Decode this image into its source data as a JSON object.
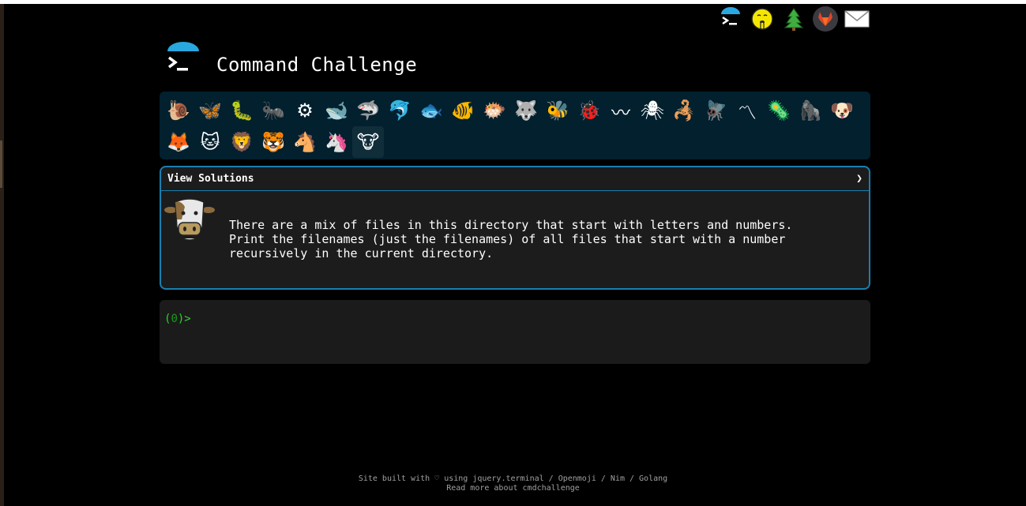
{
  "header": {
    "title": "Command Challenge",
    "links": [
      {
        "name": "home-link",
        "icon": "terminal-icon"
      },
      {
        "name": "hint-link",
        "icon": "lips-finger-emoji-icon"
      },
      {
        "name": "tree-link",
        "icon": "evergreen-tree-icon"
      },
      {
        "name": "gitlab-link",
        "icon": "gitlab-fox-icon"
      },
      {
        "name": "email-link",
        "icon": "envelope-icon"
      }
    ]
  },
  "animals": {
    "row1": [
      {
        "id": "snail",
        "glyph": "🐌"
      },
      {
        "id": "butterfly",
        "glyph": "🦋"
      },
      {
        "id": "caterpillar",
        "glyph": "🐛"
      },
      {
        "id": "ant",
        "glyph": "🐜"
      },
      {
        "id": "gear-bug",
        "glyph": "⚙"
      },
      {
        "id": "whale",
        "glyph": "🐋"
      },
      {
        "id": "shark",
        "glyph": "🦈"
      },
      {
        "id": "dolphin",
        "glyph": "🐬"
      },
      {
        "id": "fish",
        "glyph": "🐟"
      },
      {
        "id": "tropical-fish",
        "glyph": "🐠"
      },
      {
        "id": "blowfish",
        "glyph": "🐡"
      },
      {
        "id": "wolf",
        "glyph": "🐺"
      },
      {
        "id": "bee",
        "glyph": "🐝"
      },
      {
        "id": "ladybug",
        "glyph": "🐞"
      },
      {
        "id": "worm",
        "glyph": "〰"
      },
      {
        "id": "spider",
        "glyph": "🕷"
      },
      {
        "id": "scorpion",
        "glyph": "🦂"
      },
      {
        "id": "fly",
        "glyph": "🪰"
      },
      {
        "id": "earthworm",
        "glyph": "〽"
      },
      {
        "id": "microbe",
        "glyph": "🦠"
      },
      {
        "id": "gorilla",
        "glyph": "🦍"
      },
      {
        "id": "dog",
        "glyph": "🐶"
      }
    ],
    "row2": [
      {
        "id": "fox",
        "glyph": "🦊"
      },
      {
        "id": "cat",
        "glyph": "🐱"
      },
      {
        "id": "lion",
        "glyph": "🦁"
      },
      {
        "id": "tiger",
        "glyph": "🐯"
      },
      {
        "id": "horse",
        "glyph": "🐴"
      },
      {
        "id": "unicorn",
        "glyph": "🦄"
      },
      {
        "id": "cow",
        "glyph": "🐮"
      }
    ]
  },
  "challenge": {
    "header_label": "View Solutions",
    "chevron": "❯",
    "text": "There are a mix of files in this directory that start with letters and numbers.\nPrint the filenames (just the filenames) of all files that start with a number\nrecursively in the current directory."
  },
  "terminal": {
    "prompt_open": "(",
    "prompt_count": "0",
    "prompt_close": ")>"
  },
  "footer": {
    "line1": "Site built with ♡ using jquery.terminal / Openmoji / Nim / Golang",
    "line2": "Read more about cmdchallenge"
  },
  "colors": {
    "background": "#000000",
    "animal_bar": "#02202e",
    "accent": "#1a7fb0",
    "panel": "#1c1c1c",
    "prompt": "#2bd62b"
  }
}
